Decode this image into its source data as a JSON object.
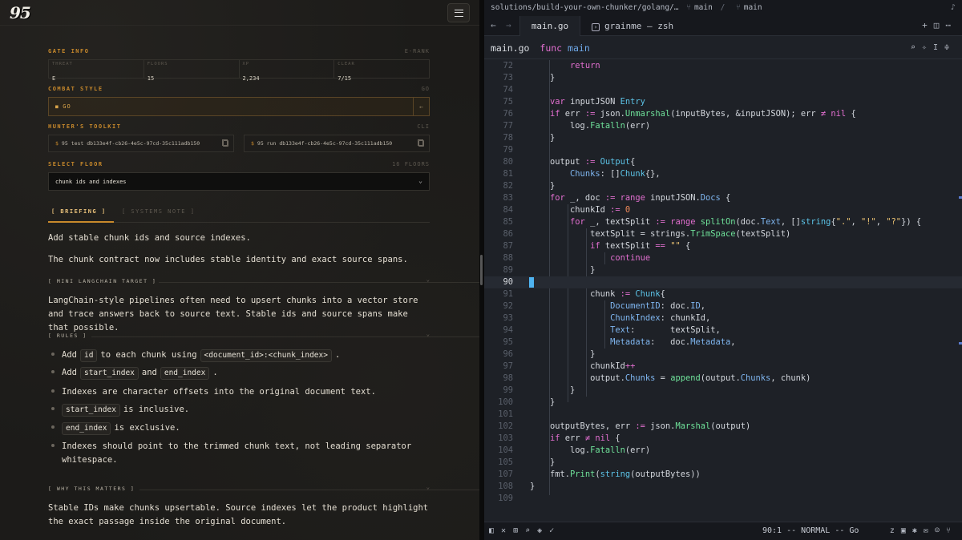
{
  "left": {
    "logo": "95",
    "gate": {
      "title": "GATE INFO",
      "rank": "E-RANK",
      "cells": [
        {
          "k": "THREAT",
          "v": "E"
        },
        {
          "k": "FLOORS",
          "v": "15"
        },
        {
          "k": "XP",
          "v": "2,234"
        },
        {
          "k": "CLEAR",
          "v": "7/15"
        }
      ]
    },
    "combat": {
      "title": "COMBAT STYLE",
      "right": "GO",
      "value": "GO"
    },
    "toolkit": {
      "title": "HUNTER'S TOOLKIT",
      "right": "CLI",
      "cmd1": "95 test db133e4f-cb26-4e5c-97cd-35c111adb150",
      "cmd2": "95 run db133e4f-cb26-4e5c-97cd-35c111adb150"
    },
    "floor": {
      "title": "SELECT FLOOR",
      "right": "16 FLOORS",
      "value": "chunk ids and indexes"
    },
    "tabs": {
      "briefing": "[ BRIEFING ]",
      "systems": "[ SYSTEMS NOTE ]"
    },
    "intro1": "Add stable chunk ids and source indexes.",
    "intro2": "The chunk contract now includes stable identity and exact source spans.",
    "target": {
      "title": "[ MINI LANGCHAIN TARGET ]",
      "body": "LangChain-style pipelines often need to upsert chunks into a vector store and trace answers back to source text. Stable ids and source spans make that possible."
    },
    "rules": {
      "title": "[ RULES ]",
      "r1a": "Add",
      "r1code1": "id",
      "r1b": "to each chunk using",
      "r1code2": "<document_id>:<chunk_index>",
      "r1c": ".",
      "r2a": "Add",
      "r2code1": "start_index",
      "r2b": "and",
      "r2code2": "end_index",
      "r2c": ".",
      "r3": "Indexes are character offsets into the original document text.",
      "r4code": "start_index",
      "r4b": "is inclusive.",
      "r5code": "end_index",
      "r5b": "is exclusive.",
      "r6": "Indexes should point to the trimmed chunk text, not leading separator whitespace."
    },
    "why": {
      "title": "[ WHY THIS MATTERS ]",
      "body": "Stable IDs make chunks upsertable. Source indexes let the product highlight the exact passage inside the original document."
    }
  },
  "editor": {
    "path": "solutions/build-your-own-chunker/golang/…",
    "branch1": "main",
    "branch2": "main",
    "tab_active": "main.go",
    "tab_terminal": "grainme — zsh",
    "crumb_file": "main.go",
    "crumb_kw": "func",
    "crumb_fn": "main",
    "status_pos": "90:1",
    "status_mode": "-- NORMAL --",
    "status_lang": "Go",
    "icons": {
      "title_alert": "bell-icon",
      "tab_add": "plus-icon",
      "split": "split-icon",
      "more": "more-icon"
    }
  }
}
